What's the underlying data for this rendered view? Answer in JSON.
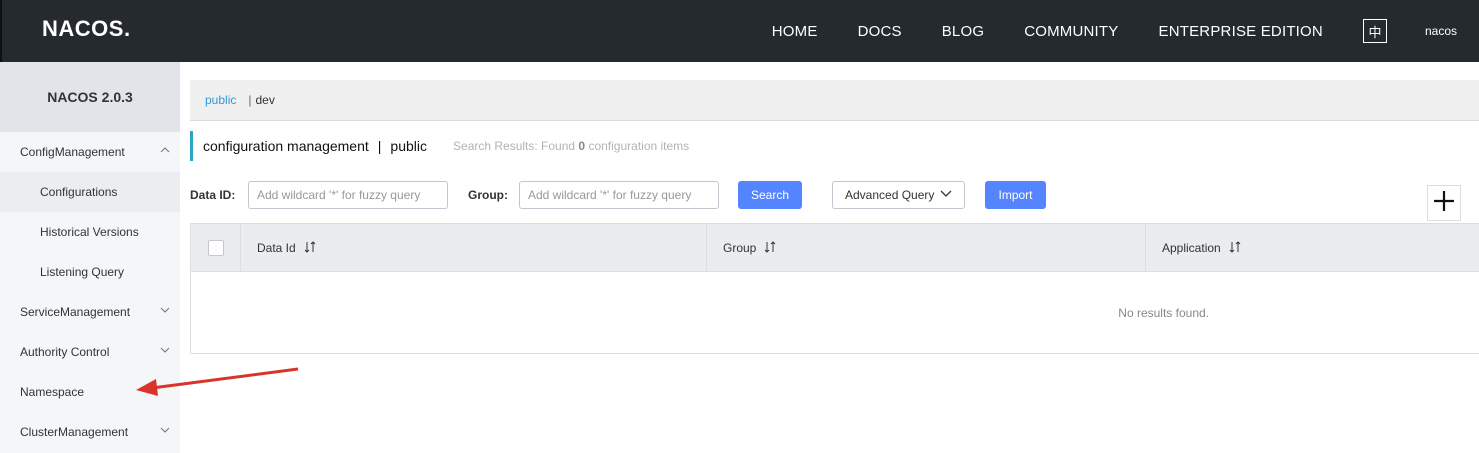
{
  "header": {
    "logo_text": "NACOS.",
    "nav": [
      "HOME",
      "DOCS",
      "BLOG",
      "COMMUNITY",
      "ENTERPRISE EDITION"
    ],
    "lang_toggle": "中",
    "user": "nacos"
  },
  "sidebar": {
    "title": "NACOS 2.0.3",
    "sections": [
      {
        "label": "ConfigManagement",
        "expanded": true,
        "icon": "chevron-up-icon"
      },
      {
        "label": "ServiceManagement",
        "icon": "chevron-down-icon"
      },
      {
        "label": "Authority Control",
        "icon": "chevron-down-icon"
      },
      {
        "label": "Namespace"
      },
      {
        "label": "ClusterManagement",
        "icon": "chevron-down-icon"
      }
    ],
    "config_sub": [
      "Configurations",
      "Historical Versions",
      "Listening Query"
    ]
  },
  "namespace_bar": {
    "active": "public",
    "separator": "|",
    "other": "dev"
  },
  "title": {
    "text": "configuration management",
    "separator": "|",
    "namespace": "public",
    "results_prefix": "Search Results: Found",
    "results_count": "0",
    "results_suffix": "configuration items"
  },
  "filters": {
    "data_id_label": "Data ID:",
    "data_id_placeholder": "Add wildcard '*' for fuzzy query",
    "group_label": "Group:",
    "group_placeholder": "Add wildcard '*' for fuzzy query",
    "search_label": "Search",
    "advanced_label": "Advanced Query",
    "import_label": "Import",
    "add_icon": "plus-icon"
  },
  "table": {
    "columns": [
      "Data Id",
      "Group",
      "Application"
    ],
    "sort_icon": "sort-icon",
    "empty_text": "No results found."
  },
  "colors": {
    "topbar": "#252a2f",
    "primary": "#5584ff",
    "accent": "#2aa4c9",
    "annotation_arrow": "#d9342b"
  }
}
